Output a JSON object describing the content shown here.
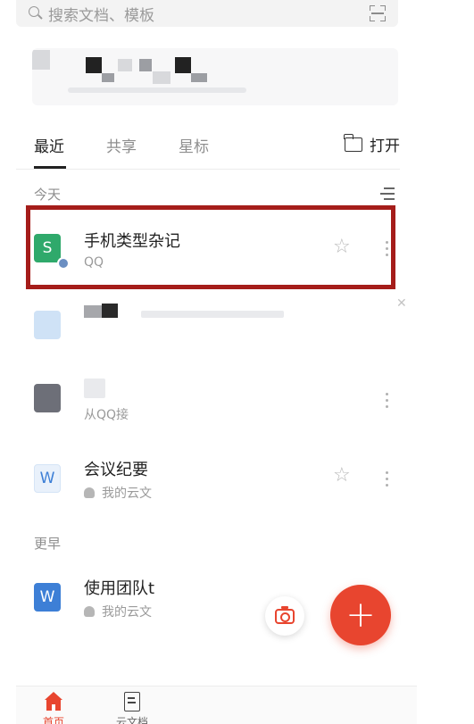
{
  "search": {
    "placeholder": "搜索文档、模板",
    "icon": "search-icon",
    "scan_icon": "scan-icon"
  },
  "tabs": [
    {
      "label": "最近",
      "active": true
    },
    {
      "label": "共享",
      "active": false
    },
    {
      "label": "星标",
      "active": false
    }
  ],
  "open_button": {
    "label": "打开",
    "icon": "folder-icon"
  },
  "sections": {
    "today": "今天",
    "earlier": "更早"
  },
  "files": [
    {
      "title": "手机类型杂记",
      "subtitle": "QQ",
      "type": "sheet",
      "icon_letter": "S",
      "starred_icon": "star-outline-icon",
      "highlighted": true
    },
    {
      "title": "",
      "subtitle": "",
      "type": "blurred"
    },
    {
      "title": "",
      "subtitle": "从QQ接",
      "type": "blurred"
    },
    {
      "title": "会议纪要",
      "subtitle": "我的云文",
      "type": "word",
      "icon_letter": "W",
      "starred_icon": "star-outline-icon"
    },
    {
      "title": "使用团队t",
      "subtitle": "我的云文",
      "type": "word",
      "icon_letter": "W"
    }
  ],
  "fab": {
    "label": "+",
    "icon": "plus-icon"
  },
  "camera_button": {
    "icon": "camera-icon"
  },
  "bottom_nav": [
    {
      "label": "首页",
      "icon": "home-icon",
      "active": true
    },
    {
      "label": "云文档",
      "icon": "document-icon",
      "active": false
    }
  ],
  "colors": {
    "accent": "#e8452f",
    "highlight_border": "#a51d1a",
    "sheet_green": "#2fa96b",
    "word_blue": "#3d7fd6"
  }
}
